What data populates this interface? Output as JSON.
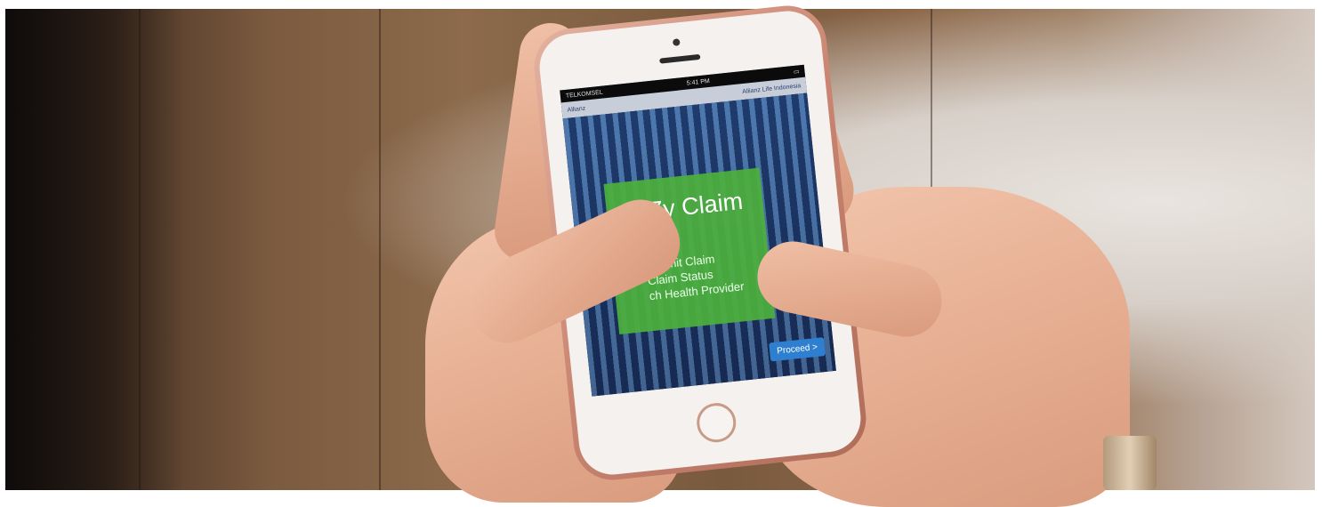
{
  "phone_screen": {
    "status_bar": {
      "carrier": "TELKOMSEL",
      "time": "5:41 PM",
      "battery": ""
    },
    "header": {
      "brand": "Allianz",
      "company": "Allianz Life Indonesia"
    },
    "title": "eAZy Claim",
    "menu_items": [
      "Submit Claim",
      "Claim Status",
      "ch Health Provider"
    ],
    "proceed_label": "Proceed >"
  },
  "colors": {
    "panel_green": "#4caf3d",
    "button_blue": "#2f7fd0",
    "phone_rose_gold": "#c98571"
  }
}
